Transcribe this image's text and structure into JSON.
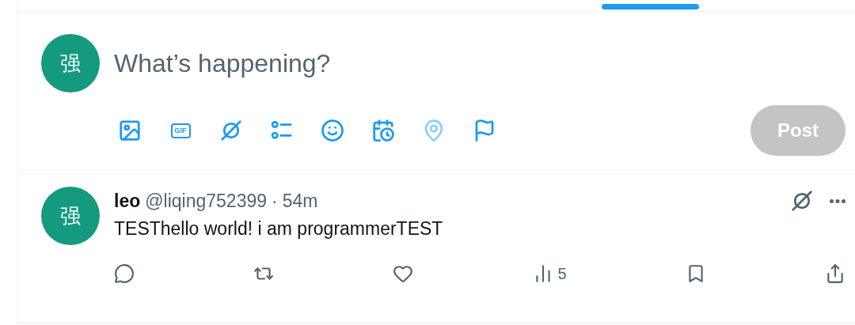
{
  "composer": {
    "avatar": "强",
    "placeholder": "What’s happening?",
    "tools": [
      {
        "kind": "image",
        "disabled": false
      },
      {
        "kind": "gif",
        "label": "GIF",
        "disabled": false
      },
      {
        "kind": "grok",
        "disabled": false
      },
      {
        "kind": "poll",
        "disabled": false
      },
      {
        "kind": "emoji",
        "disabled": false
      },
      {
        "kind": "schedule",
        "disabled": false
      },
      {
        "kind": "location",
        "disabled": true
      },
      {
        "kind": "flag",
        "disabled": false
      }
    ],
    "post_button": {
      "label": "Post",
      "disabled": true
    }
  },
  "tweet": {
    "avatar": "强",
    "name": "leo",
    "handle": "@liqing752399",
    "separator": "·",
    "time": "54m",
    "text": "TESThello world! i am programmerTEST",
    "actions": [
      {
        "kind": "reply"
      },
      {
        "kind": "retweet"
      },
      {
        "kind": "like"
      },
      {
        "kind": "views",
        "count": "5"
      },
      {
        "kind": "bookmark"
      },
      {
        "kind": "share"
      }
    ]
  }
}
